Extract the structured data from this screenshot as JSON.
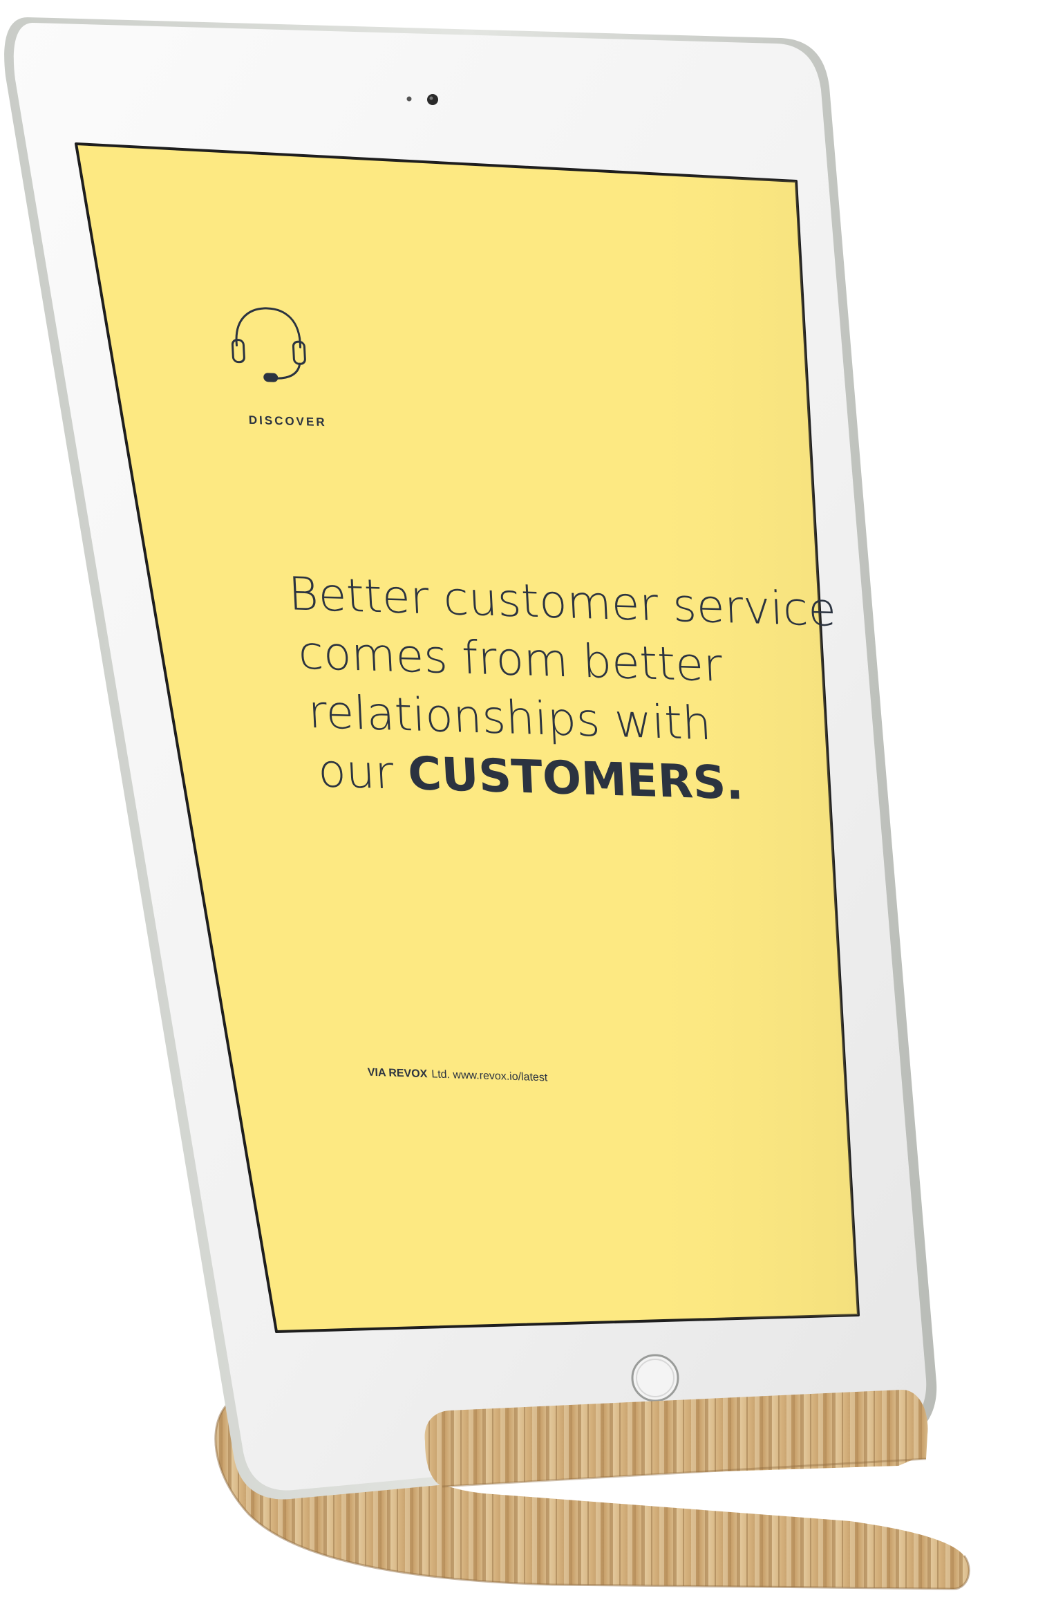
{
  "screen": {
    "category_label": "DISCOVER",
    "category_icon": "headset-icon",
    "headline": {
      "line1": "Better customer service",
      "line2": "comes from better",
      "line3": "relationships with",
      "line4_prefix": "our ",
      "line4_emphasis": "CUSTOMERS."
    },
    "footer": {
      "brand": "VIA REVOX",
      "suffix": "Ltd. www.revox.io/latest"
    }
  },
  "colors": {
    "screen_background": "#fde982",
    "text": "#2b3340",
    "device_frame": "#f2f2f2",
    "device_edge": "#cfd1cf",
    "wood_light": "#d9bb8c",
    "wood_dark": "#b08a5a"
  }
}
